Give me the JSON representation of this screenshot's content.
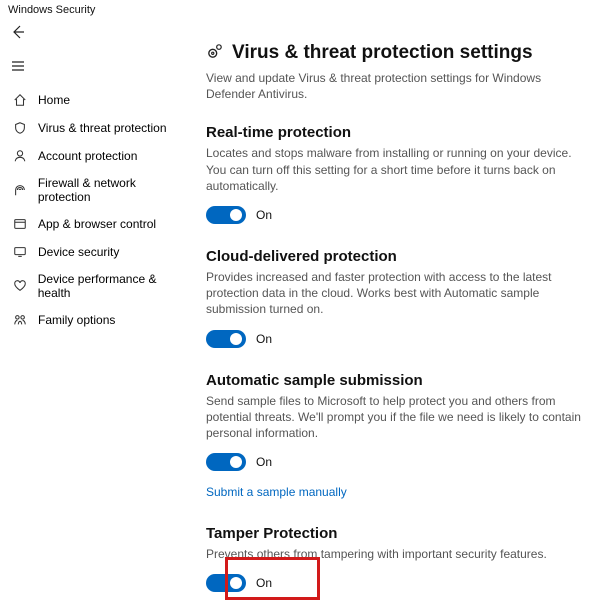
{
  "window": {
    "title": "Windows Security"
  },
  "sidebar": {
    "items": [
      {
        "label": "Home"
      },
      {
        "label": "Virus & threat protection"
      },
      {
        "label": "Account protection"
      },
      {
        "label": "Firewall & network protection"
      },
      {
        "label": "App & browser control"
      },
      {
        "label": "Device security"
      },
      {
        "label": "Device performance & health"
      },
      {
        "label": "Family options"
      }
    ]
  },
  "page": {
    "title": "Virus & threat protection settings",
    "subtitle": "View and update Virus & threat protection settings for Windows Defender Antivirus."
  },
  "sections": {
    "realtime": {
      "title": "Real-time protection",
      "desc": "Locates and stops malware from installing or running on your device. You can turn off this setting for a short time before it turns back on automatically.",
      "state": "On"
    },
    "cloud": {
      "title": "Cloud-delivered protection",
      "desc": "Provides increased and faster protection with access to the latest protection data in the cloud.  Works best with Automatic sample submission turned on.",
      "state": "On"
    },
    "sample": {
      "title": "Automatic sample submission",
      "desc": "Send sample files to Microsoft to help protect you and others from potential threats.  We'll prompt you if the file we need is likely to contain personal information.",
      "state": "On",
      "link": "Submit a sample manually"
    },
    "tamper": {
      "title": "Tamper Protection",
      "desc": "Prevents others from tampering with important security features.",
      "state": "On"
    }
  }
}
